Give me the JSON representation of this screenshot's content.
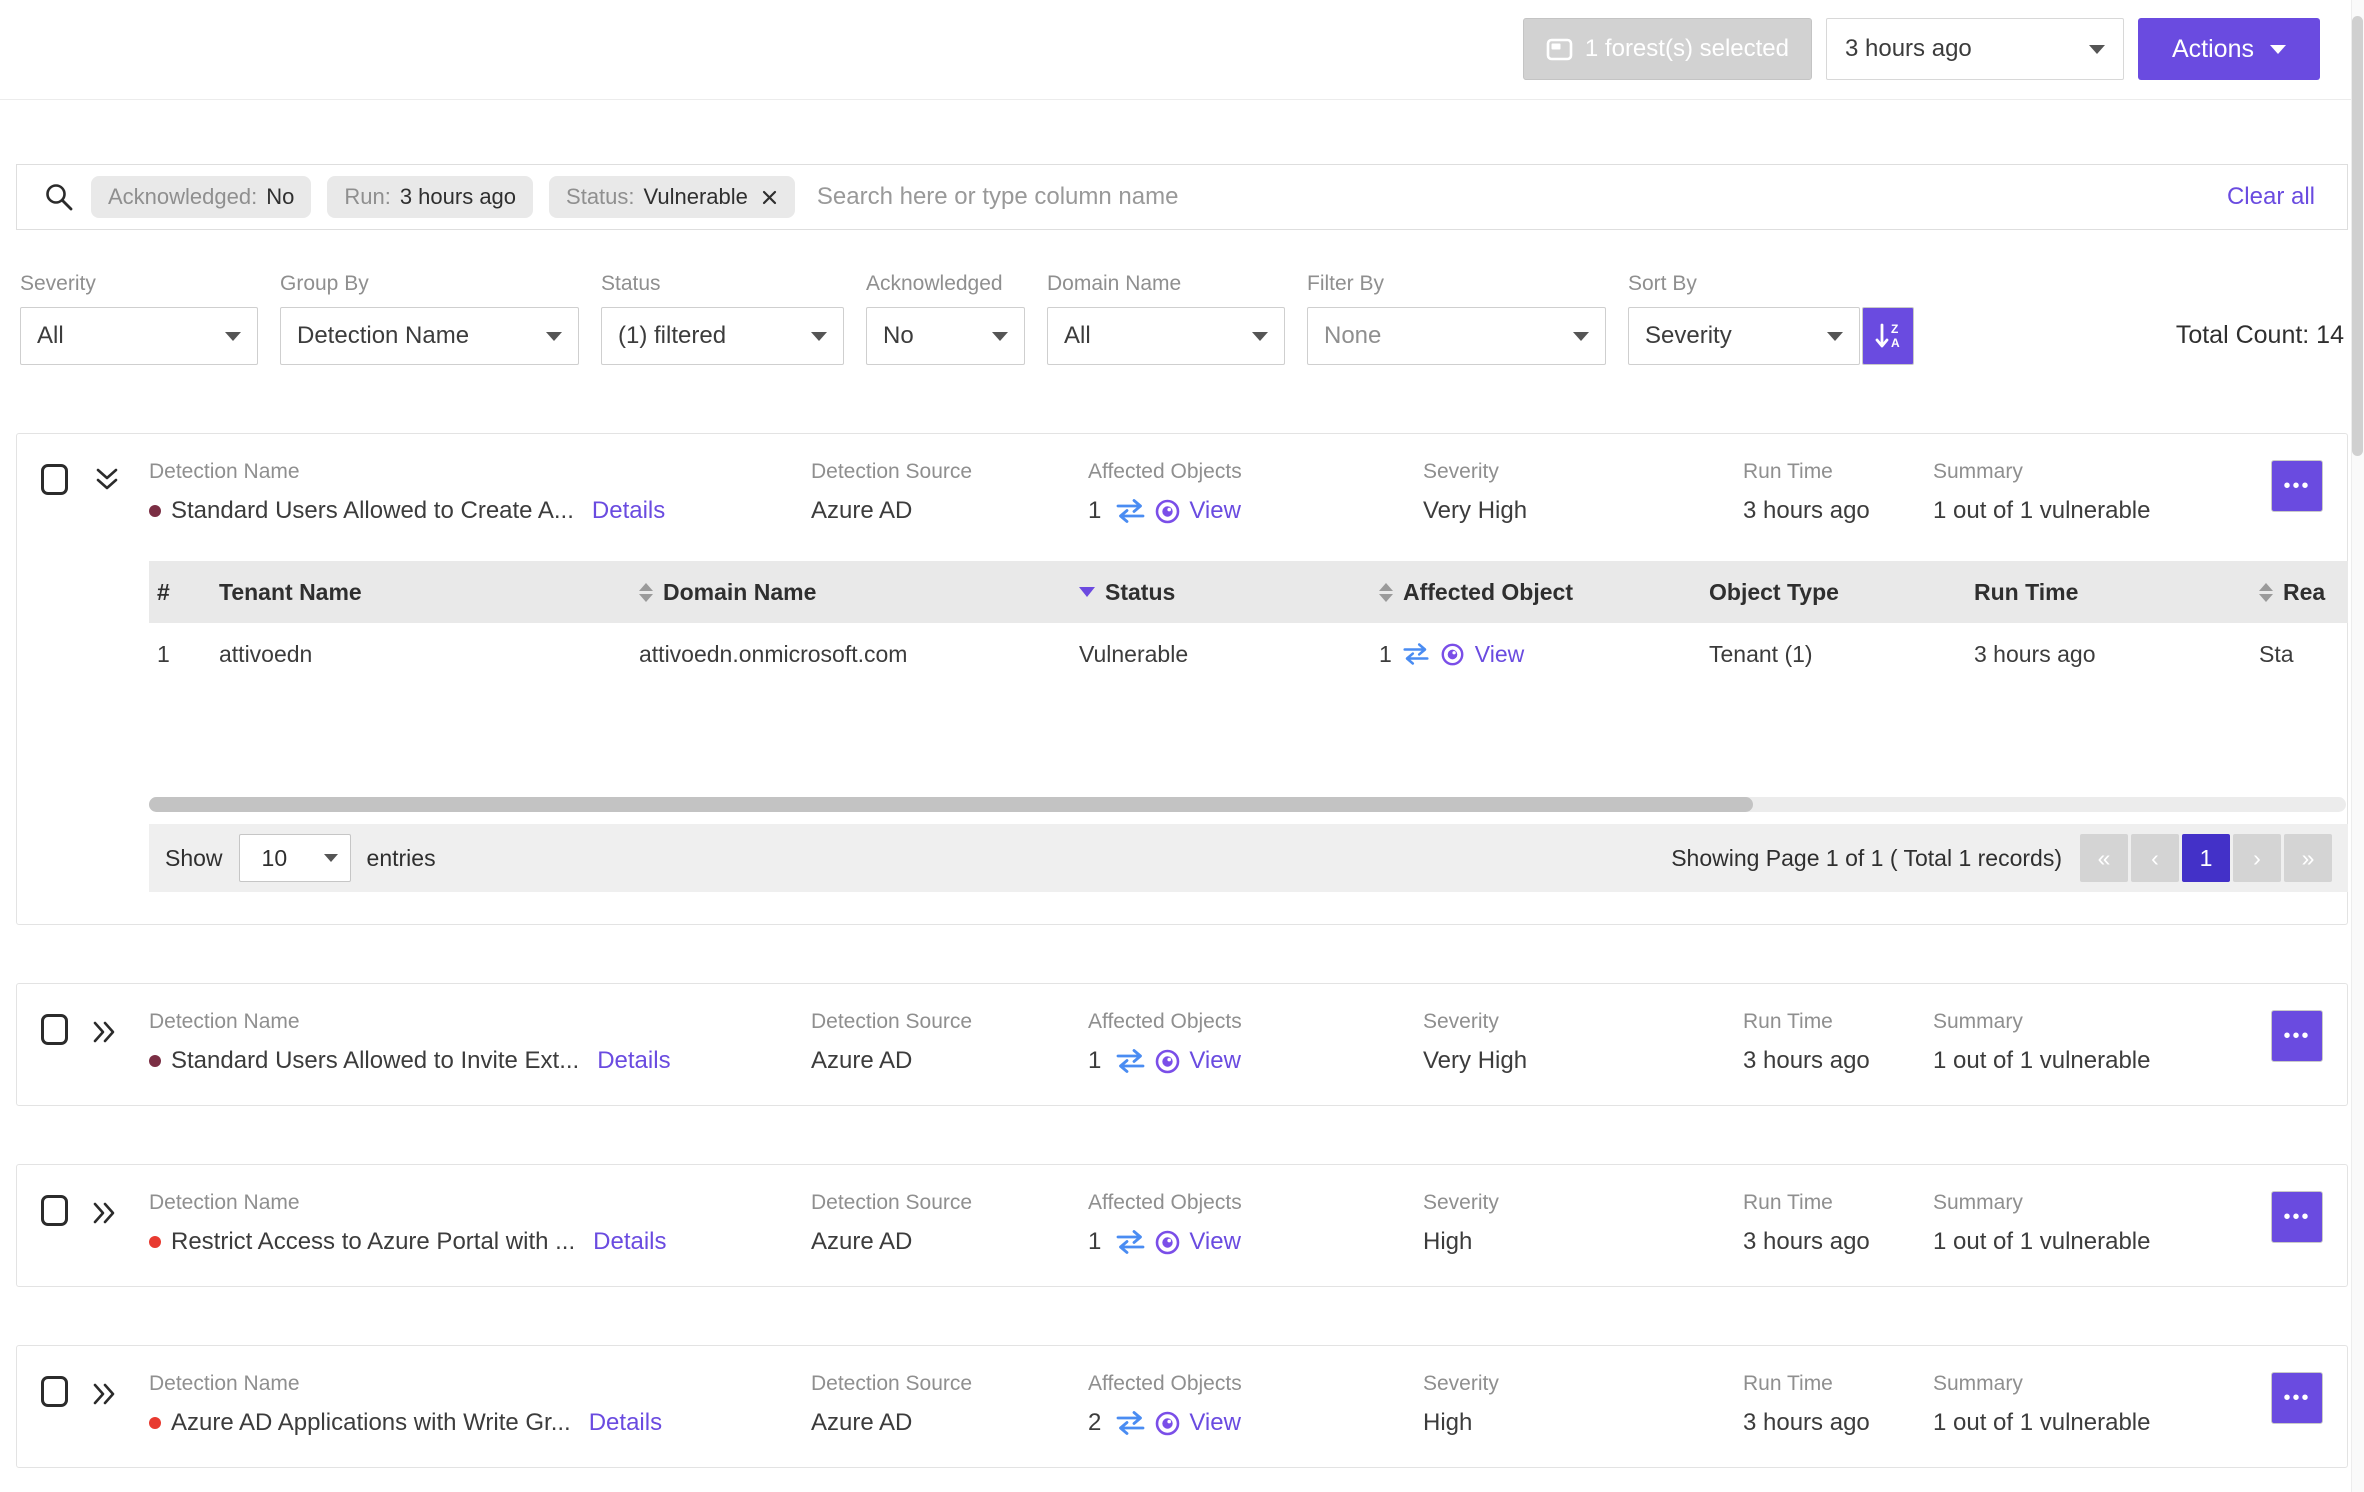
{
  "colors": {
    "accent_purple": "#6a4be0",
    "pager_active": "#4331c8",
    "swap_icon_blue": "#4a8cf2",
    "severity_very_high_bullet": "#7b2e44",
    "severity_high_bullet": "#e83a30"
  },
  "topbar": {
    "forest_button_label": "1 forest(s) selected",
    "time_dropdown_value": "3 hours ago",
    "actions_button_label": "Actions"
  },
  "search": {
    "chips": [
      {
        "label": "Acknowledged:",
        "value": "No"
      },
      {
        "label": "Run:",
        "value": "3 hours ago"
      },
      {
        "label": "Status:",
        "value": "Vulnerable"
      }
    ],
    "placeholder": "Search here or type column name",
    "clear_all_label": "Clear all"
  },
  "filters": [
    {
      "label": "Severity",
      "value": "All"
    },
    {
      "label": "Group By",
      "value": "Detection Name"
    },
    {
      "label": "Status",
      "value": "(1) filtered"
    },
    {
      "label": "Acknowledged",
      "value": "No"
    },
    {
      "label": "Domain Name",
      "value": "All"
    },
    {
      "label": "Filter By",
      "value": "None"
    },
    {
      "label": "Sort By",
      "value": "Severity"
    }
  ],
  "total_count_label": "Total Count: 14",
  "card_labels": {
    "name": "Detection Name",
    "source": "Detection Source",
    "affected": "Affected Objects",
    "severity": "Severity",
    "run": "Run Time",
    "summary": "Summary",
    "details": "Details",
    "view": "View"
  },
  "cards": [
    {
      "name": "Standard Users Allowed to Create A...",
      "bullet_color": "#7b2e44",
      "source": "Azure AD",
      "affected_count": "1",
      "severity": "Very High",
      "run_time": "3 hours ago",
      "summary": "1 out of 1 vulnerable"
    },
    {
      "name": "Standard Users Allowed to Invite Ext...",
      "bullet_color": "#7b2e44",
      "source": "Azure AD",
      "affected_count": "1",
      "severity": "Very High",
      "run_time": "3 hours ago",
      "summary": "1 out of 1 vulnerable"
    },
    {
      "name": "Restrict Access to Azure Portal with ...",
      "bullet_color": "#e83a30",
      "source": "Azure AD",
      "affected_count": "1",
      "severity": "High",
      "run_time": "3 hours ago",
      "summary": "1 out of 1 vulnerable"
    },
    {
      "name": "Azure AD Applications with Write Gr...",
      "bullet_color": "#e83a30",
      "source": "Azure AD",
      "affected_count": "2",
      "severity": "High",
      "run_time": "3 hours ago",
      "summary": "1 out of 1 vulnerable"
    }
  ],
  "detail_table": {
    "columns": [
      "#",
      "Tenant Name",
      "Domain Name",
      "Status",
      "Affected Object",
      "Object Type",
      "Run Time",
      "Rea"
    ],
    "row": {
      "num": "1",
      "tenant": "attivoedn",
      "domain": "attivoedn.onmicrosoft.com",
      "status": "Vulnerable",
      "affected_count": "1",
      "view_label": "View",
      "object_type": "Tenant (1)",
      "run_time": "3 hours ago",
      "reason": "Sta"
    }
  },
  "table_footer": {
    "show_label": "Show",
    "page_size": "10",
    "entries_label": "entries",
    "page_info": "Showing Page 1 of 1 ( Total 1 records)",
    "pager_first": "«",
    "pager_prev": "‹",
    "pager_page": "1",
    "pager_next": "›",
    "pager_last": "»"
  }
}
